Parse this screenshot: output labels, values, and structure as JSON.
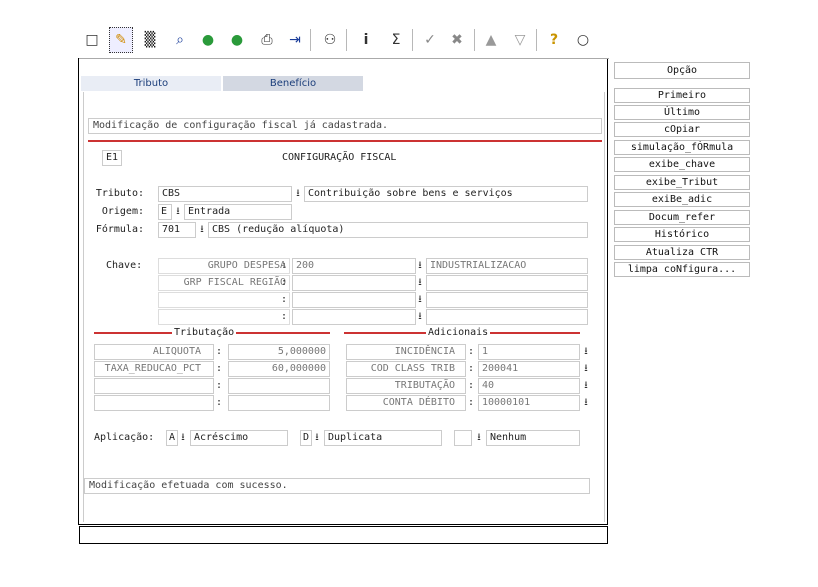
{
  "toolbar": {
    "icons": [
      "new-icon",
      "edit-icon",
      "delete-icon",
      "search-icon",
      "go-next-icon",
      "go-prev-icon",
      "print-icon",
      "export-icon",
      "binoculars-icon",
      "info-icon",
      "sum-icon",
      "confirm-icon",
      "cancel-tools-icon",
      "up-icon",
      "down-icon",
      "help-icon",
      "comment-icon"
    ],
    "glyphs": [
      "□",
      "✎",
      "▒",
      "⌕",
      "●",
      "●",
      "⎙",
      "⇥",
      "⚇",
      "i",
      "Σ",
      "✓",
      "✖",
      "▲",
      "▽",
      "?",
      "○"
    ]
  },
  "tabs": {
    "tributo": "Tributo",
    "beneficio": "Benefício"
  },
  "message_top": "Modificação de configuração fiscal já cadastrada.",
  "header": {
    "code": "E1",
    "title": "CONFIGURAÇÃO FISCAL"
  },
  "form": {
    "tributo_label": "Tributo:",
    "tributo_code": "CBS",
    "tributo_desc": "Contribuição sobre bens e serviços",
    "origem_label": "Origem:",
    "origem_code": "E",
    "origem_desc": "Entrada",
    "formula_label": "Fórmula:",
    "formula_code": "701",
    "formula_desc": "CBS (redução alíquota)"
  },
  "chave": {
    "label": "Chave:",
    "rows": [
      {
        "name": "GRUPO DESPESA",
        "code": "200",
        "desc": "INDUSTRIALIZACAO"
      },
      {
        "name": "GRP FISCAL REGIÃO",
        "code": "",
        "desc": ""
      },
      {
        "name": "",
        "code": "",
        "desc": ""
      },
      {
        "name": "",
        "code": "",
        "desc": ""
      }
    ]
  },
  "tributacao": {
    "title": "Tributação",
    "rows": [
      {
        "name": "ALIQUOTA",
        "value": "5,000000"
      },
      {
        "name": "TAXA_REDUCAO_PCT",
        "value": "60,000000"
      },
      {
        "name": "",
        "value": ""
      },
      {
        "name": "",
        "value": ""
      }
    ]
  },
  "adicionais": {
    "title": "Adicionais",
    "rows": [
      {
        "name": "INCIDÊNCIA",
        "value": "1"
      },
      {
        "name": "COD CLASS TRIB",
        "value": "200041"
      },
      {
        "name": "TRIBUTAÇÃO",
        "value": "40"
      },
      {
        "name": "CONTA DÉBITO",
        "value": "10000101"
      }
    ]
  },
  "aplicacao": {
    "label": "Aplicação:",
    "a_code": "A",
    "a_desc": "Acréscimo",
    "d_code": "D",
    "d_desc": "Duplicata",
    "n_code": "",
    "n_desc": "Nenhum"
  },
  "message_bottom": "Modificação efetuada com sucesso.",
  "side": {
    "opcao": "Opção",
    "buttons": [
      "Primeiro",
      "Último",
      "cOpiar",
      "simulação_fÓRmula",
      "exibe_chave",
      "exibe_Tribut",
      "exiBe_adic",
      "Docum_refer",
      "Histórico",
      "Atualiza CTR",
      "limpa coNfigura..."
    ]
  },
  "colors": {
    "accent_red": "#cc3333",
    "tab_text": "#1a3d7a"
  }
}
